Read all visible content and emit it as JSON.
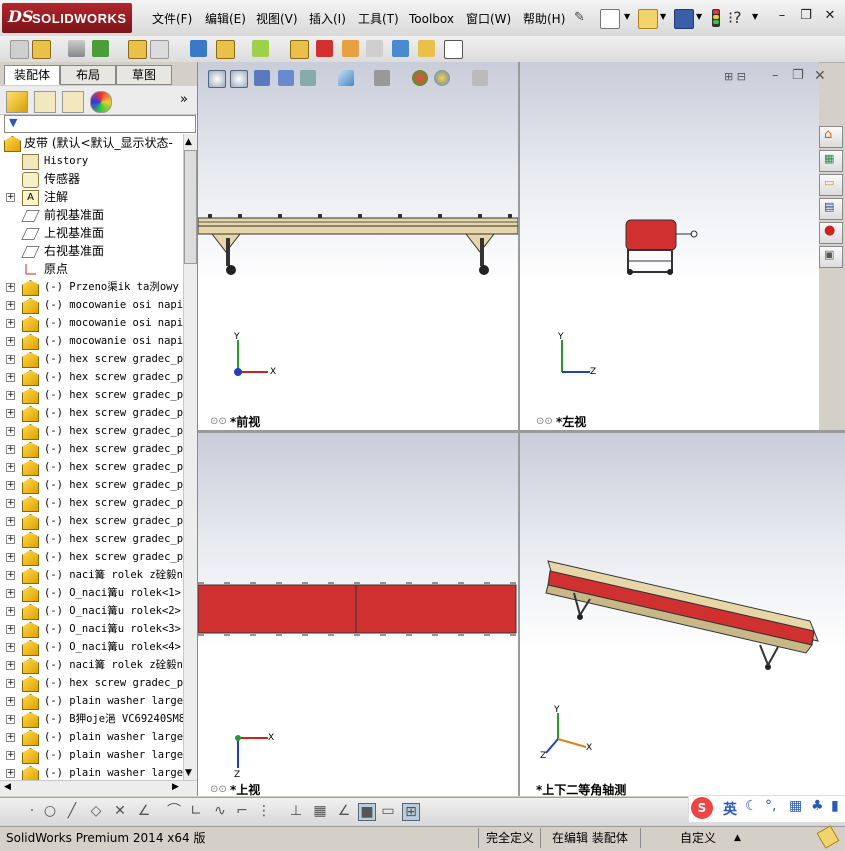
{
  "app": {
    "logo_ds": "DS",
    "logo_name": "SOLIDWORKS"
  },
  "menu": [
    "文件(F)",
    "编辑(E)",
    "视图(V)",
    "插入(I)",
    "工具(T)",
    "Toolbox",
    "窗口(W)",
    "帮助(H)"
  ],
  "panel_tabs": [
    "装配体",
    "布局",
    "草图"
  ],
  "tree": {
    "root": "皮带  (默认<默认_显示状态-",
    "items": [
      {
        "label": "History",
        "icon": "history-icon",
        "expand": false
      },
      {
        "label": "传感器",
        "icon": "sensor-icon",
        "expand": false
      },
      {
        "label": "注解",
        "icon": "annotation-icon",
        "expand": true
      },
      {
        "label": "前视基准面",
        "icon": "plane-icon",
        "expand": false
      },
      {
        "label": "上视基准面",
        "icon": "plane-icon",
        "expand": false
      },
      {
        "label": "右视基准面",
        "icon": "plane-icon",
        "expand": false
      },
      {
        "label": "原点",
        "icon": "origin-icon",
        "expand": false
      },
      {
        "label": "(-) Przeno渠ik ta洌owy",
        "icon": "subassembly-icon",
        "expand": true
      },
      {
        "label": "(-) mocowanie osi napin",
        "icon": "subassembly-icon",
        "expand": true
      },
      {
        "label": "(-) mocowanie osi napin",
        "icon": "subassembly-icon",
        "expand": true
      },
      {
        "label": "(-) mocowanie osi napin",
        "icon": "subassembly-icon",
        "expand": true
      },
      {
        "label": "(-) hex screw gradec_pe",
        "icon": "part-icon",
        "expand": true
      },
      {
        "label": "(-) hex screw gradec_pe",
        "icon": "part-icon",
        "expand": true
      },
      {
        "label": "(-) hex screw gradec_pe",
        "icon": "part-icon",
        "expand": true
      },
      {
        "label": "(-) hex screw gradec_pe",
        "icon": "part-icon",
        "expand": true
      },
      {
        "label": "(-) hex screw gradec_pe",
        "icon": "part-icon",
        "expand": true
      },
      {
        "label": "(-) hex screw gradec_pe",
        "icon": "part-icon",
        "expand": true
      },
      {
        "label": "(-) hex screw gradec_pe",
        "icon": "part-icon",
        "expand": true
      },
      {
        "label": "(-) hex screw gradec_pe",
        "icon": "part-icon",
        "expand": true
      },
      {
        "label": "(-) hex screw gradec_pe",
        "icon": "part-icon",
        "expand": true
      },
      {
        "label": "(-) hex screw gradec_pe",
        "icon": "part-icon",
        "expand": true
      },
      {
        "label": "(-) hex screw gradec_pe",
        "icon": "part-icon",
        "expand": true
      },
      {
        "label": "(-) hex screw gradec_pe",
        "icon": "part-icon",
        "expand": true
      },
      {
        "label": "(-) naci篝 rolek z硂毅n",
        "icon": "part-icon",
        "expand": true
      },
      {
        "label": "(-) O_naci篝u rolek<1>",
        "icon": "part-icon",
        "expand": true
      },
      {
        "label": "(-) O_naci篝u rolek<2>",
        "icon": "part-icon",
        "expand": true
      },
      {
        "label": "(-) O_naci篝u rolek<3>",
        "icon": "part-icon",
        "expand": true
      },
      {
        "label": "(-) O_naci篝u rolek<4>",
        "icon": "part-icon",
        "expand": true
      },
      {
        "label": "(-) naci篝 rolek z硂毅n",
        "icon": "part-icon",
        "expand": true
      },
      {
        "label": "(-) hex screw gradec_pe",
        "icon": "part-icon",
        "expand": true
      },
      {
        "label": "(-) plain washer large",
        "icon": "part-icon",
        "expand": true
      },
      {
        "label": "(-) B狎oje浥 VC69240SM8",
        "icon": "part-icon",
        "expand": true
      },
      {
        "label": "(-) plain washer large",
        "icon": "part-icon",
        "expand": true
      },
      {
        "label": "(-) plain washer large",
        "icon": "part-icon",
        "expand": true
      },
      {
        "label": "(-) plain washer large",
        "icon": "part-icon",
        "expand": true
      }
    ]
  },
  "viewports": {
    "front": "*前视",
    "left": "*左视",
    "top": "*上视",
    "iso": "*上下二等角轴测"
  },
  "axes": {
    "x": "X",
    "y": "Y",
    "z": "Z"
  },
  "status": {
    "product": "SolidWorks Premium 2014 x64 版",
    "definition": "完全定义",
    "editing": "在编辑 装配体",
    "units": "自定义"
  },
  "ime": {
    "lang": "英"
  },
  "colors": {
    "belt_red": "#d03030",
    "frame_tan": "#e6d6a8",
    "logo_red": "#b3262d",
    "background_top": "#c9cdd9"
  }
}
